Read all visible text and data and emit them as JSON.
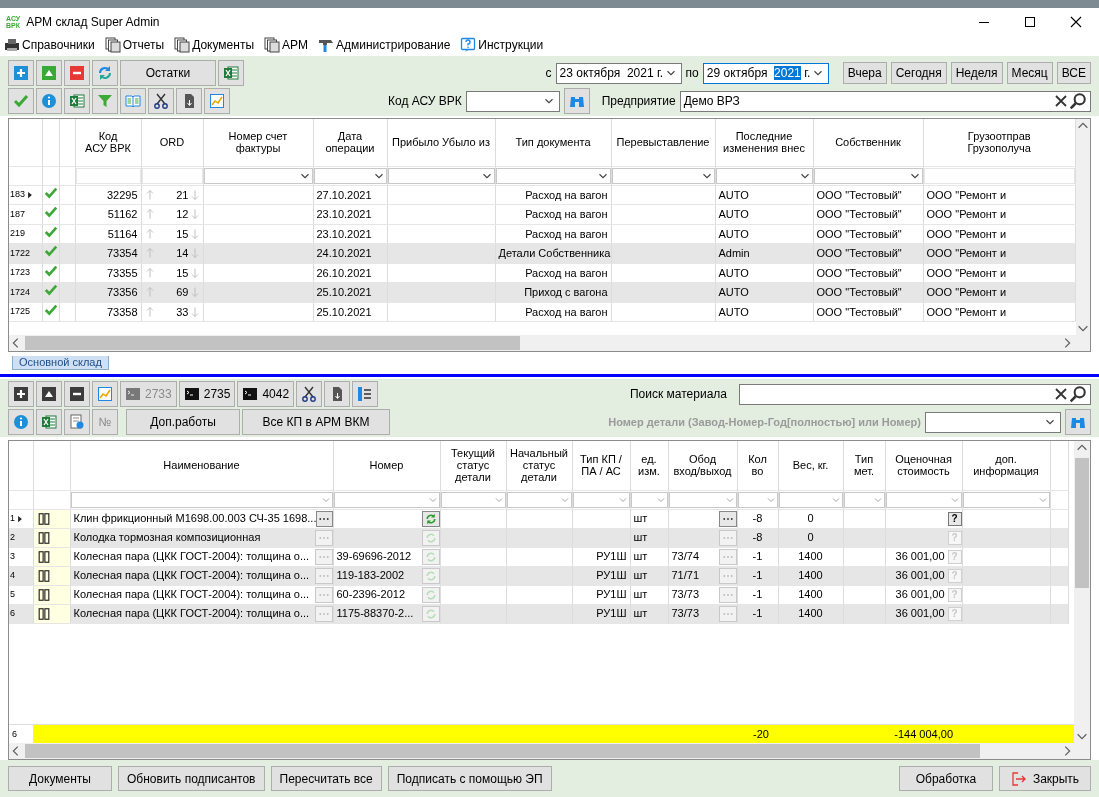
{
  "window": {
    "logo": [
      "АСУ",
      "ВРК"
    ],
    "title": "АРМ склад Super Admin"
  },
  "menu": [
    "Справочники",
    "Отчеты",
    "Документы",
    "АРМ",
    "Администрирование",
    "Инструкции"
  ],
  "toolbar": {
    "remains_button": "Остатки",
    "date_from_label": "с",
    "date_from": [
      {
        "text": "23 октября  2021 г.",
        "selected": false
      }
    ],
    "date_to_label": "по",
    "date_to": [
      {
        "text": "29 октября  ",
        "selected": false
      },
      {
        "text": "2021",
        "selected": true
      },
      {
        "text": " г.",
        "selected": false
      }
    ],
    "periods": [
      "Вчера",
      "Сегодня",
      "Неделя",
      "Месяц",
      "ВСЕ"
    ],
    "code_label": "Код АСУ ВРК",
    "enterprise_label": "Предприятие",
    "enterprise": "Демо ВРЗ"
  },
  "documents_table": {
    "columns": [
      {
        "label": "Код\nАСУ ВРК",
        "filter": false
      },
      {
        "label": "ORD",
        "filter": false
      },
      {
        "label": "Номер счет фактуры",
        "filter": true
      },
      {
        "label": "Дата\nоперации",
        "filter": true
      },
      {
        "label": "Прибыло Убыло из",
        "filter": true
      },
      {
        "label": "Тип документа",
        "filter": true
      },
      {
        "label": "Перевыставление",
        "filter": true
      },
      {
        "label": "Последние\nизменения внес",
        "filter": true
      },
      {
        "label": "Собственник",
        "filter": true
      },
      {
        "label": "Грузоотправ\nГрузополуча",
        "filter": false
      }
    ],
    "rows": [
      {
        "num": "183",
        "current": true,
        "confirmed": true,
        "highlighted": false,
        "code": "32295",
        "ord": "21",
        "date": "27.10.2021",
        "doc_type": "Расход на вагон",
        "changed_by": "AUTO",
        "owner": "ООО \"Тестовый\"",
        "consignee": "ООО \"Ремонт и"
      },
      {
        "num": "187",
        "current": false,
        "confirmed": true,
        "highlighted": false,
        "code": "51162",
        "ord": "12",
        "date": "23.10.2021",
        "doc_type": "Расход на вагон",
        "changed_by": "AUTO",
        "owner": "ООО \"Тестовый\"",
        "consignee": "ООО \"Ремонт и"
      },
      {
        "num": "219",
        "current": false,
        "confirmed": true,
        "highlighted": false,
        "code": "51164",
        "ord": "15",
        "date": "23.10.2021",
        "doc_type": "Расход на вагон",
        "changed_by": "AUTO",
        "owner": "ООО \"Тестовый\"",
        "consignee": "ООО \"Ремонт и"
      },
      {
        "num": "1722",
        "current": false,
        "confirmed": true,
        "highlighted": true,
        "code": "73354",
        "ord": "14",
        "date": "24.10.2021",
        "doc_type": "Детали Собственника",
        "changed_by": "Admin",
        "owner": "ООО \"Тестовый\"",
        "consignee": "ООО \"Ремонт и"
      },
      {
        "num": "1723",
        "current": false,
        "confirmed": true,
        "highlighted": false,
        "code": "73355",
        "ord": "15",
        "date": "26.10.2021",
        "doc_type": "Расход на вагон",
        "changed_by": "AUTO",
        "owner": "ООО \"Тестовый\"",
        "consignee": "ООО \"Ремонт и"
      },
      {
        "num": "1724",
        "current": false,
        "confirmed": true,
        "highlighted": true,
        "code": "73356",
        "ord": "69",
        "date": "25.10.2021",
        "doc_type": "Приход с вагона",
        "changed_by": "AUTO",
        "owner": "ООО \"Тестовый\"",
        "consignee": "ООО \"Ремонт и"
      },
      {
        "num": "1725",
        "current": false,
        "confirmed": true,
        "highlighted": false,
        "code": "73358",
        "ord": "33",
        "date": "25.10.2021",
        "doc_type": "Расход на вагон",
        "changed_by": "AUTO",
        "owner": "ООО \"Тестовый\"",
        "consignee": "ООО \"Ремонт и"
      }
    ]
  },
  "tabs": [
    {
      "label": "Основной склад",
      "selected": true
    }
  ],
  "materials_toolbar": {
    "counters": [
      {
        "label": "2733",
        "disabled": true
      },
      {
        "label": "2735",
        "disabled": false
      },
      {
        "label": "4042",
        "disabled": false
      }
    ],
    "search_label": "Поиск материала",
    "part_label": "Номер детали (Завод-Номер-Год[полностью] или Номер)",
    "part_label_disabled": true,
    "number_button": {
      "label": "№",
      "disabled": true
    },
    "extra_buttons": [
      "Доп.работы",
      "Все КП в АРМ ВКМ"
    ]
  },
  "materials_table": {
    "columns": [
      "Наименование",
      "Номер",
      "Текущий\nстатус\nдетали",
      "Начальный\nстатус\nдетали",
      "Тип КП /\nПА / АС",
      "ед.\nизм.",
      "Обод\nвход/выход",
      "Кол\nво",
      "Вес, кг.",
      "Тип\nмет.",
      "Оценочная\nстоимость",
      "доп.\nинформация"
    ],
    "rows": [
      {
        "num": "1",
        "current": true,
        "active": true,
        "highlighted": false,
        "name": "Клин фрикционный М1698.00.003 СЧ-35 1698...",
        "unit": "шт",
        "qty": "-8",
        "weight": "0",
        "help": "?"
      },
      {
        "num": "2",
        "current": false,
        "active": false,
        "highlighted": true,
        "name": "Колодка тормозная композиционная",
        "unit": "шт",
        "qty": "-8",
        "weight": "0",
        "help": "?"
      },
      {
        "num": "3",
        "current": false,
        "active": false,
        "highlighted": false,
        "name": "Колесная пара (ЦКК ГОСТ-2004): толщина о...",
        "number": "39-69696-2012",
        "type": "РУ1Ш",
        "unit": "шт",
        "rim": "73/74",
        "qty": "-1",
        "weight": "1400",
        "cost": "36 001,00",
        "help": "?"
      },
      {
        "num": "4",
        "current": false,
        "active": false,
        "highlighted": true,
        "name": "Колесная пара (ЦКК ГОСТ-2004): толщина о...",
        "number": "119-183-2002",
        "type": "РУ1Ш",
        "unit": "шт",
        "rim": "71/71",
        "qty": "-1",
        "weight": "1400",
        "cost": "36 001,00",
        "help": "?"
      },
      {
        "num": "5",
        "current": false,
        "active": false,
        "highlighted": false,
        "name": "Колесная пара (ЦКК ГОСТ-2004): толщина о...",
        "number": "60-2396-2012",
        "type": "РУ1Ш",
        "unit": "шт",
        "rim": "73/73",
        "qty": "-1",
        "weight": "1400",
        "cost": "36 001,00",
        "help": "?"
      },
      {
        "num": "6",
        "current": false,
        "active": false,
        "highlighted": true,
        "name": "Колесная пара (ЦКК ГОСТ-2004): толщина о...",
        "number": "1175-88370-2...",
        "type": "РУ1Ш",
        "unit": "шт",
        "rim": "73/73",
        "qty": "-1",
        "weight": "1400",
        "cost": "36 001,00",
        "help": "?"
      }
    ],
    "totals": {
      "count": "6",
      "qty": "-20",
      "cost": "-144 004,00"
    }
  },
  "footer_left": [
    "Документы",
    "Обновить подписантов",
    "Пересчитать все",
    "Подписать с помощью ЭП"
  ],
  "footer_right": [
    {
      "label": "Обработка",
      "kind": "plain"
    },
    {
      "label": "Закрыть",
      "kind": "exit"
    }
  ]
}
